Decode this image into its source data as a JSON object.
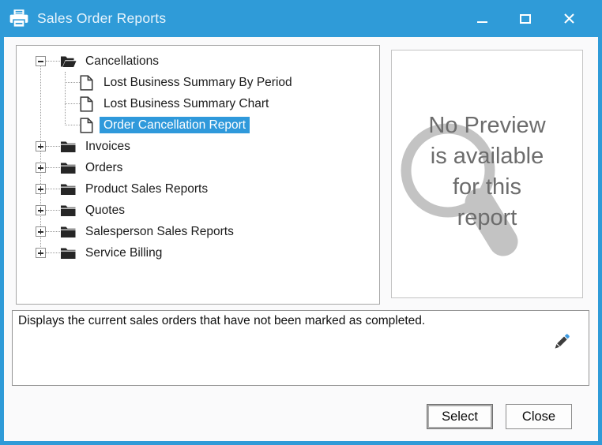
{
  "window": {
    "title": "Sales Order Reports",
    "accent_color": "#2F9BD8"
  },
  "tree": {
    "items": [
      {
        "label": "Cancellations",
        "level": 0,
        "toggle": "minus",
        "icon": "folder-open",
        "expanded": true,
        "selected": false
      },
      {
        "label": "Lost Business Summary By Period",
        "level": 1,
        "icon": "document",
        "selected": false
      },
      {
        "label": "Lost Business Summary Chart",
        "level": 1,
        "icon": "document",
        "selected": false
      },
      {
        "label": "Order Cancellation Report",
        "level": 1,
        "icon": "document",
        "selected": true
      },
      {
        "label": "Invoices",
        "level": 0,
        "toggle": "plus",
        "icon": "folder-closed",
        "selected": false
      },
      {
        "label": "Orders",
        "level": 0,
        "toggle": "plus",
        "icon": "folder-closed",
        "selected": false
      },
      {
        "label": "Product Sales Reports",
        "level": 0,
        "toggle": "plus",
        "icon": "folder-closed",
        "selected": false
      },
      {
        "label": "Quotes",
        "level": 0,
        "toggle": "plus",
        "icon": "folder-closed",
        "selected": false
      },
      {
        "label": "Salesperson Sales Reports",
        "level": 0,
        "toggle": "plus",
        "icon": "folder-closed",
        "selected": false
      },
      {
        "label": "Service Billing",
        "level": 0,
        "toggle": "plus",
        "icon": "folder-closed",
        "selected": false
      }
    ],
    "selected_item": "Order Cancellation Report",
    "selection_color": "#2F99DB"
  },
  "preview": {
    "message": "No Preview\nis available\nfor this\nreport"
  },
  "description": {
    "text": "Displays the current sales orders that have not been marked as completed."
  },
  "footer": {
    "select_label": "Select",
    "close_label": "Close"
  },
  "icons": {
    "titlebar_icon": "printer-icon",
    "preview_icon": "magnifier-icon",
    "description_icon": "pencil-edit-icon"
  }
}
